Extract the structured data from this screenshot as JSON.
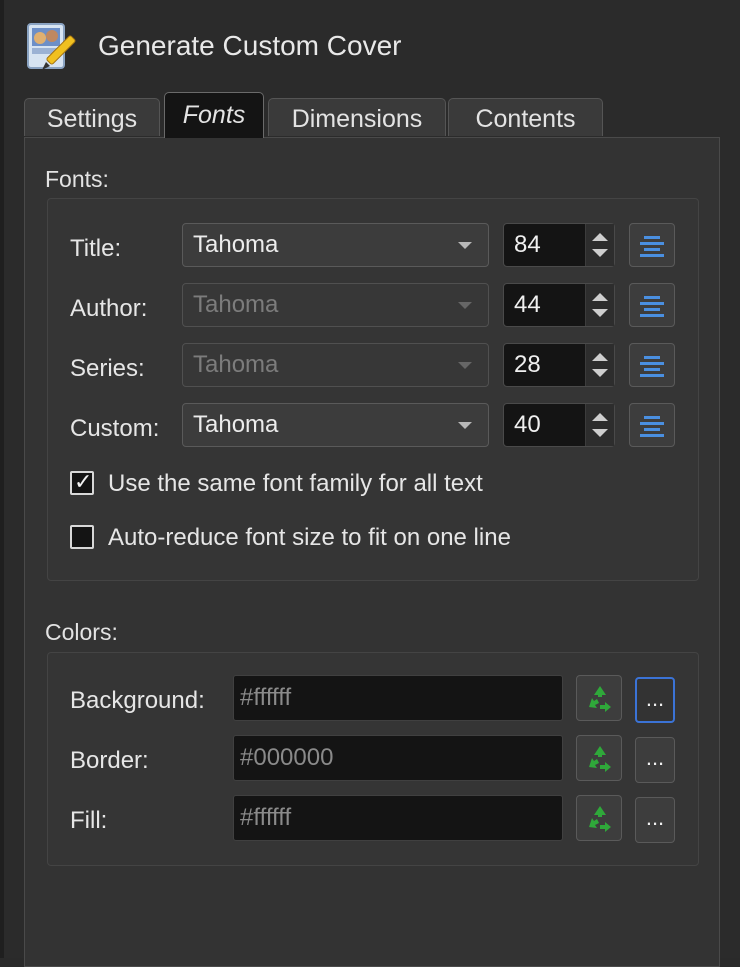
{
  "window": {
    "title": "Generate Custom Cover"
  },
  "tabs": [
    {
      "label": "Settings",
      "active": false
    },
    {
      "label": "Fonts",
      "active": true
    },
    {
      "label": "Dimensions",
      "active": false
    },
    {
      "label": "Contents",
      "active": false
    }
  ],
  "fonts": {
    "section_label": "Fonts:",
    "rows": [
      {
        "label": "Title:",
        "font": "Tahoma",
        "size": "84",
        "enabled": true
      },
      {
        "label": "Author:",
        "font": "Tahoma",
        "size": "44",
        "enabled": false
      },
      {
        "label": "Series:",
        "font": "Tahoma",
        "size": "28",
        "enabled": false
      },
      {
        "label": "Custom:",
        "font": "Tahoma",
        "size": "40",
        "enabled": true
      }
    ],
    "same_family": {
      "label": "Use the same font family for all text",
      "checked": true
    },
    "auto_reduce": {
      "label": "Auto-reduce font size to fit on one line",
      "checked": false
    }
  },
  "colors": {
    "section_label": "Colors:",
    "rows": [
      {
        "label": "Background:",
        "value": "#ffffff"
      },
      {
        "label": "Border:",
        "value": "#000000"
      },
      {
        "label": "Fill:",
        "value": "#ffffff"
      }
    ],
    "more_label": "..."
  },
  "icons": {
    "align": "align-center-icon",
    "reset": "recycle-icon",
    "app": "cover-generator-icon"
  },
  "theme": {
    "accent": "#3b73d6",
    "recycle_green": "#2fa83a",
    "align_blue": "#4a8fe0"
  }
}
